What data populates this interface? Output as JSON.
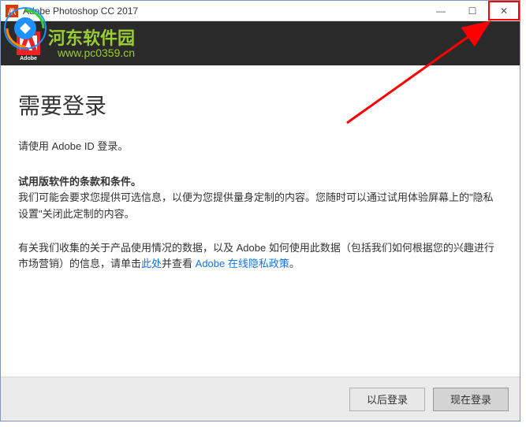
{
  "titlebar": {
    "title": "Adobe Photoshop CC 2017",
    "minimize": "—",
    "maximize": "☐",
    "close": "✕"
  },
  "header": {
    "adobe_label": "Adobe"
  },
  "watermark": {
    "text": "河东软件园",
    "url": "www.pc0359.cn"
  },
  "content": {
    "main_title": "需要登录",
    "subtitle": "请使用 Adobe ID 登录。",
    "terms_title": "试用版软件的条款和条件。",
    "terms_text": "我们可能会要求您提供可选信息，以便为您提供量身定制的内容。您随时可以通过试用体验屏幕上的\"隐私设置\"关闭此定制的内容。",
    "data_text_1": "有关我们收集的关于产品使用情况的数据，以及 Adobe 如何使用此数据（包括我们如何根据您的兴趣进行市场营销）的信息，请单击",
    "link_here": "此处",
    "data_text_2": "并查看 ",
    "link_policy": "Adobe 在线隐私政策",
    "data_text_3": "。"
  },
  "footer": {
    "later_label": "以后登录",
    "now_label": "现在登录"
  }
}
